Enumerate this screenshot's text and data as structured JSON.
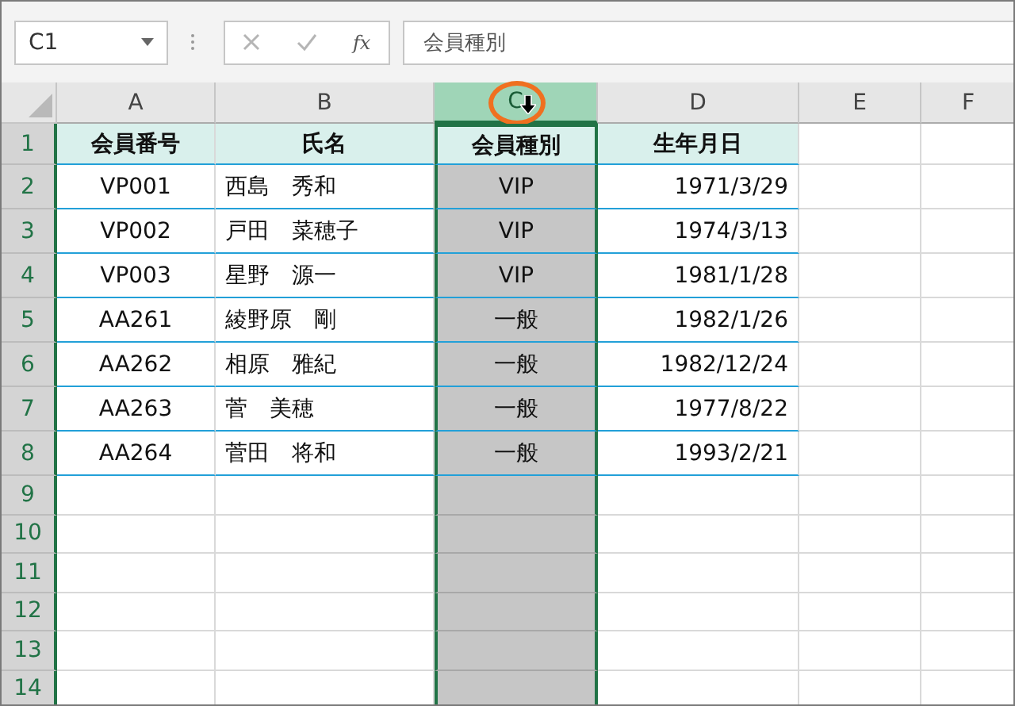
{
  "name_box": {
    "value": "C1"
  },
  "formula_bar": {
    "function_label": "fx",
    "value": "会員種別"
  },
  "columns": [
    {
      "label": "A",
      "selected": false
    },
    {
      "label": "B",
      "selected": false
    },
    {
      "label": "C",
      "selected": true
    },
    {
      "label": "D",
      "selected": false
    },
    {
      "label": "E",
      "selected": false
    },
    {
      "label": "F",
      "selected": false
    }
  ],
  "rows": [
    {
      "number": "1",
      "cells": [
        "会員番号",
        "氏名",
        "会員種別",
        "生年月日"
      ]
    },
    {
      "number": "2",
      "cells": [
        "VP001",
        "西島　秀和",
        "VIP",
        "1971/3/29"
      ]
    },
    {
      "number": "3",
      "cells": [
        "VP002",
        "戸田　菜穂子",
        "VIP",
        "1974/3/13"
      ]
    },
    {
      "number": "4",
      "cells": [
        "VP003",
        "星野　源一",
        "VIP",
        "1981/1/28"
      ]
    },
    {
      "number": "5",
      "cells": [
        "AA261",
        "綾野原　剛",
        "一般",
        "1982/1/26"
      ]
    },
    {
      "number": "6",
      "cells": [
        "AA262",
        "相原　雅紀",
        "一般",
        "1982/12/24"
      ]
    },
    {
      "number": "7",
      "cells": [
        "AA263",
        "菅　美穂",
        "一般",
        "1977/8/22"
      ]
    },
    {
      "number": "8",
      "cells": [
        "AA264",
        "菅田　将和",
        "一般",
        "1993/2/21"
      ]
    },
    {
      "number": "9",
      "cells": []
    },
    {
      "number": "10",
      "cells": []
    },
    {
      "number": "11",
      "cells": []
    },
    {
      "number": "12",
      "cells": []
    },
    {
      "number": "13",
      "cells": []
    },
    {
      "number": "14",
      "cells": []
    }
  ]
}
